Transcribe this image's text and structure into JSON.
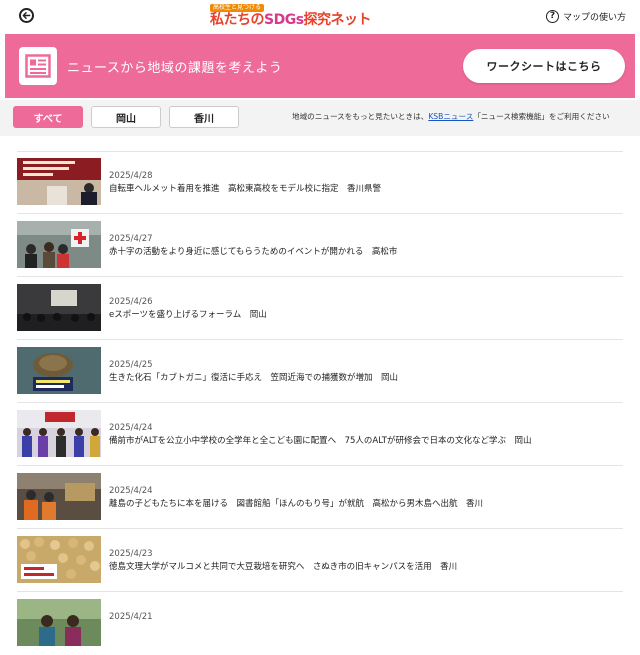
{
  "header": {
    "back_label": "",
    "logo_tagline": "高校生と見つける",
    "logo_prefix": "私たちの",
    "logo_sdgs": "SDGs",
    "logo_suffix": "探究ネット",
    "help_icon_glyph": "?",
    "help_label": "マップの使い方"
  },
  "banner": {
    "title": "ニュースから地域の課題を考えよう",
    "worksheet_button": "ワークシートはこちら",
    "color": "#ee6a99"
  },
  "filters": {
    "tabs": [
      {
        "label": "すべて",
        "active": true
      },
      {
        "label": "岡山",
        "active": false
      },
      {
        "label": "香川",
        "active": false
      }
    ]
  },
  "notice": {
    "before": "地域のニュースをもっと見たいときは、",
    "link": "KSBニュース",
    "after": "「ニュース検索機能」をご利用ください"
  },
  "news": [
    {
      "date": "2025/4/28",
      "title": "自転車ヘルメット着用を推進　高松東高校をモデル校に指定　香川県警",
      "thumb": "bike-helmet-ceremony"
    },
    {
      "date": "2025/4/27",
      "title": "赤十字の活動をより身近に感じてもらうためのイベントが開かれる　高松市",
      "thumb": "red-cross-event"
    },
    {
      "date": "2025/4/26",
      "title": "eスポーツを盛り上げるフォーラム　岡山",
      "thumb": "esports-forum"
    },
    {
      "date": "2025/4/25",
      "title": "生きた化石「カブトガニ」復活に手応え　笠岡近海での捕獲数が増加　岡山",
      "thumb": "horseshoe-crab"
    },
    {
      "date": "2025/4/24",
      "title": "備前市がALTを公立小中学校の全学年と全こども園に配置へ　75人のALTが研修会で日本の文化など学ぶ　岡山",
      "thumb": "alt-training"
    },
    {
      "date": "2025/4/24",
      "title": "離島の子どもたちに本を届ける　図書館船「ほんのもり号」が就航　高松から男木島へ出航　香川",
      "thumb": "library-boat"
    },
    {
      "date": "2025/4/23",
      "title": "徳島文理大学がマルコメと共同で大豆栽培を研究へ　さぬき市の旧キャンパスを活用　香川",
      "thumb": "soybeans"
    },
    {
      "date": "2025/4/21",
      "title": "",
      "thumb": "people-outdoor"
    }
  ]
}
